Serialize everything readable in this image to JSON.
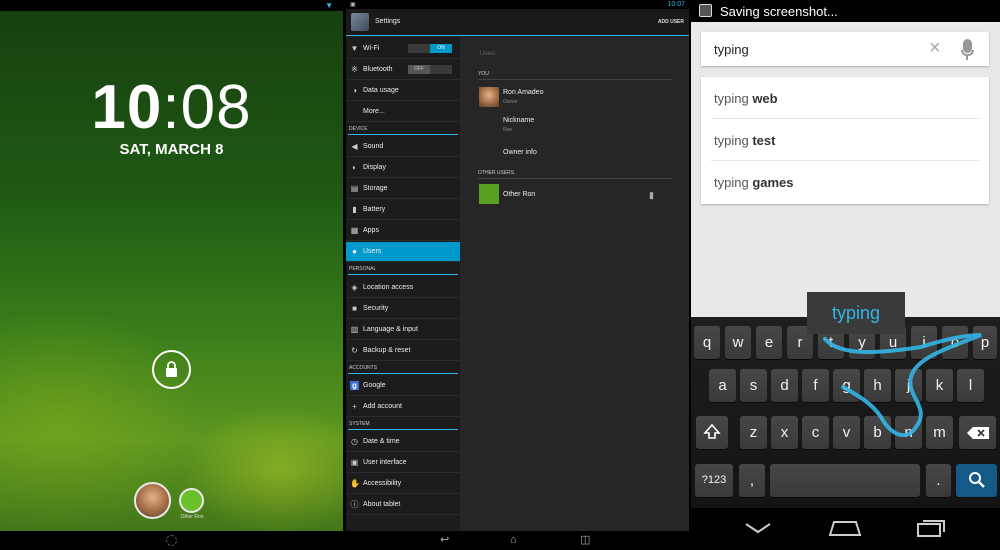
{
  "lock_screen": {
    "time_hours": "10",
    "time_sep": ":",
    "time_minutes": "08",
    "date": "SAT, MARCH 8",
    "icons": [
      "wifi-icon",
      "lock-icon",
      "user-avatar-ron",
      "user-avatar-other",
      "home-icon"
    ]
  },
  "settings": {
    "time": "10:07",
    "title": "Settings",
    "add_user": "ADD USER",
    "wifi": {
      "label": "Wi-Fi",
      "state": "ON"
    },
    "bluetooth": {
      "label": "Bluetooth",
      "state": "OFF"
    },
    "items": {
      "data_usage": "Data usage",
      "more": "More...",
      "sound": "Sound",
      "display": "Display",
      "storage": "Storage",
      "battery": "Battery",
      "apps": "Apps",
      "users": "Users",
      "location": "Location access",
      "security": "Security",
      "language": "Language & input",
      "backup": "Backup & reset",
      "google": "Google",
      "add_account": "Add account",
      "date_time": "Date & time",
      "user_interface": "User interface",
      "accessibility": "Accessibility",
      "about": "About tablet"
    },
    "headers": {
      "device": "DEVICE",
      "personal": "PERSONAL",
      "accounts": "ACCOUNTS",
      "system": "SYSTEM"
    },
    "selected": "Users",
    "main": {
      "page_label": "Users",
      "you_header": "YOU",
      "owner_name": "Ron Amadeo",
      "owner_role": "Owner",
      "nickname_label": "Nickname",
      "nickname_value": "Ron",
      "owner_info": "Owner info",
      "other_header": "OTHER USERS",
      "other_user": "Other Ron"
    }
  },
  "search": {
    "status_text": "Saving screenshot...",
    "query": "typing",
    "suggestions": [
      {
        "base": "typing ",
        "bold": "web"
      },
      {
        "base": "typing ",
        "bold": "test"
      },
      {
        "base": "typing ",
        "bold": "games"
      }
    ],
    "preview_word": "typing",
    "keyboard": {
      "row1": [
        "q",
        "w",
        "e",
        "r",
        "t",
        "y",
        "u",
        "i",
        "o",
        "p"
      ],
      "row2": [
        "a",
        "s",
        "d",
        "f",
        "g",
        "h",
        "j",
        "k",
        "l"
      ],
      "row3": [
        "z",
        "x",
        "c",
        "v",
        "b",
        "n",
        "m"
      ],
      "symbols": "?123",
      "comma": ",",
      "period": ".",
      "accent_color": "#33b5e5"
    }
  }
}
